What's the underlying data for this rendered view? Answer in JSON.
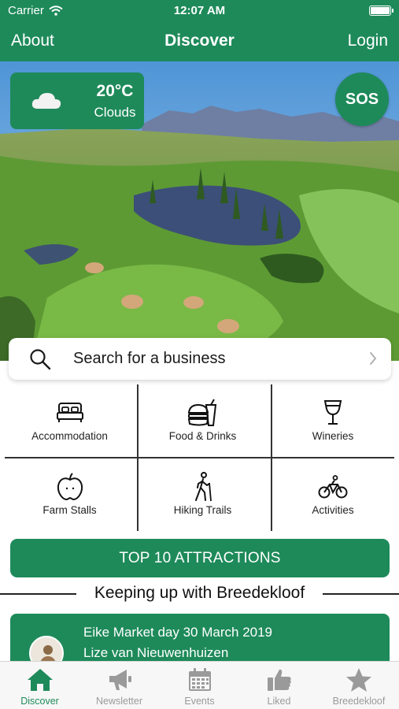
{
  "status_bar": {
    "carrier": "Carrier",
    "time": "12:07 AM"
  },
  "nav": {
    "left": "About",
    "title": "Discover",
    "right": "Login"
  },
  "weather": {
    "temperature": "20°C",
    "condition": "Clouds",
    "icon": "cloud-icon"
  },
  "sos": {
    "label": "SOS"
  },
  "search": {
    "placeholder": "Search for a business"
  },
  "categories": [
    {
      "label": "Accommodation",
      "icon": "bed-icon"
    },
    {
      "label": "Food & Drinks",
      "icon": "burger-drink-icon"
    },
    {
      "label": "Wineries",
      "icon": "wine-glass-icon"
    },
    {
      "label": "Farm Stalls",
      "icon": "apple-icon"
    },
    {
      "label": "Hiking Trails",
      "icon": "hiker-icon"
    },
    {
      "label": "Activities",
      "icon": "bicycle-icon"
    }
  ],
  "attractions_button": {
    "label": "TOP 10 ATTRACTIONS"
  },
  "section": {
    "heading": "Keeping up with Breedekloof"
  },
  "news": {
    "headline": "Eike Market day 30 March 2019",
    "author": "Lize van Nieuwenhuizen"
  },
  "tabs": [
    {
      "label": "Discover",
      "icon": "home-icon",
      "active": true
    },
    {
      "label": "Newsletter",
      "icon": "megaphone-icon",
      "active": false
    },
    {
      "label": "Events",
      "icon": "calendar-icon",
      "active": false
    },
    {
      "label": "Liked",
      "icon": "thumbs-up-icon",
      "active": false
    },
    {
      "label": "Breedekloof",
      "icon": "star-icon",
      "active": false
    }
  ],
  "colors": {
    "brand": "#1e8a5a",
    "tab_inactive": "#9a9a9a",
    "background": "#ffffff"
  }
}
